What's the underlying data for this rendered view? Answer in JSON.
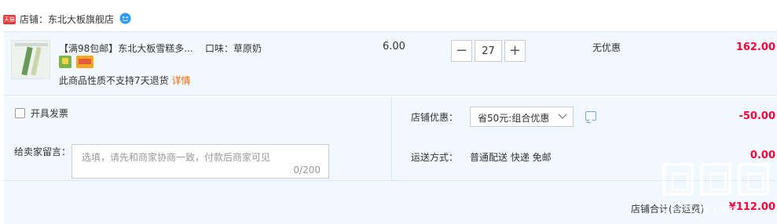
{
  "shop": {
    "badge": "天猫",
    "label": "店铺：",
    "name": "东北大板旗舰店"
  },
  "item": {
    "title": "【满98包邮】东北大板雪糕多...",
    "sku": "口味：草原奶",
    "unit_price": "6.00",
    "quantity": "27",
    "discount_text": "无优惠",
    "subtotal": "162.00",
    "return_note": "此商品性质不支持7天退货",
    "detail_link": "详情",
    "icons": [
      "service-icon",
      "card-icon"
    ]
  },
  "order": {
    "invoice_label": "开具发票",
    "memo_label": "给卖家留言：",
    "memo_placeholder": "选填，请先和商家协商一致，付款后商家可见",
    "memo_count": "0/200",
    "promo_label": "店铺优惠：",
    "promo_selected": "省50元:组合优惠",
    "promo_amount": "-50.00",
    "shipping_label": "运送方式：",
    "shipping_value": "普通配送 快递 免邮",
    "shipping_amount": "0.00",
    "total_label": "店铺合计(含运费)",
    "total_amount": "¥112.00"
  },
  "watermark": {
    "url": "zhi.hzhi.com"
  },
  "colors": {
    "price_red": "#ff0036",
    "row_bg": "#f2f8ff",
    "border_blue": "#d5e7ff",
    "link_orange": "#ff6a00"
  }
}
